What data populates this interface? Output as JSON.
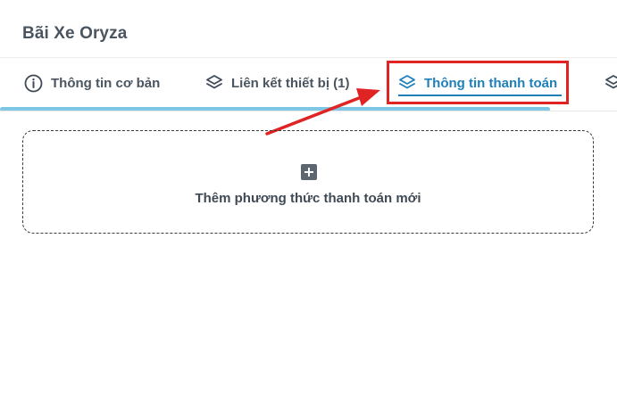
{
  "page": {
    "title": "Bãi Xe Oryza"
  },
  "tabs": [
    {
      "label": "Thông tin cơ bản",
      "icon": "info-circle-icon",
      "active": false
    },
    {
      "label": "Liên kết thiết bị (1)",
      "icon": "layers-icon",
      "active": false
    },
    {
      "label": "Thông tin thanh toán",
      "icon": "layers-icon",
      "active": true
    },
    {
      "label": "",
      "icon": "layers-icon",
      "active": false
    }
  ],
  "payment": {
    "add_label": "Thêm phương thức thanh toán mới",
    "add_icon": "plus-square-icon"
  },
  "colors": {
    "active_tab": "#1f7fb8",
    "progress": "#7ec8e6",
    "annotation": "#e02323"
  }
}
